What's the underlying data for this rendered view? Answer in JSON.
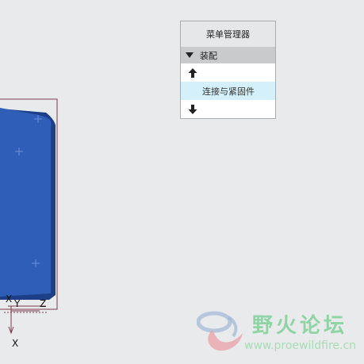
{
  "menu_manager": {
    "title": "菜单管理器",
    "section_label": "装配",
    "items": [
      {
        "label": "连接与紧固件"
      }
    ]
  },
  "model_viewport": {
    "axis_labels": {
      "x_top": "X",
      "y_top": "Y",
      "z_top": "Z",
      "x_bottom": "X"
    }
  },
  "watermark": {
    "title": "野火论坛",
    "url": "www.proewildfire.cn"
  },
  "colors": {
    "background": "#e9eaec",
    "part_blue": "#2f5eb8",
    "frame_maroon": "#7b3a4a",
    "selected_item": "#d3f0fb"
  },
  "icons": [
    "up-arrow-icon",
    "down-arrow-icon",
    "collapse-triangle-icon",
    "datum-point-icon"
  ]
}
